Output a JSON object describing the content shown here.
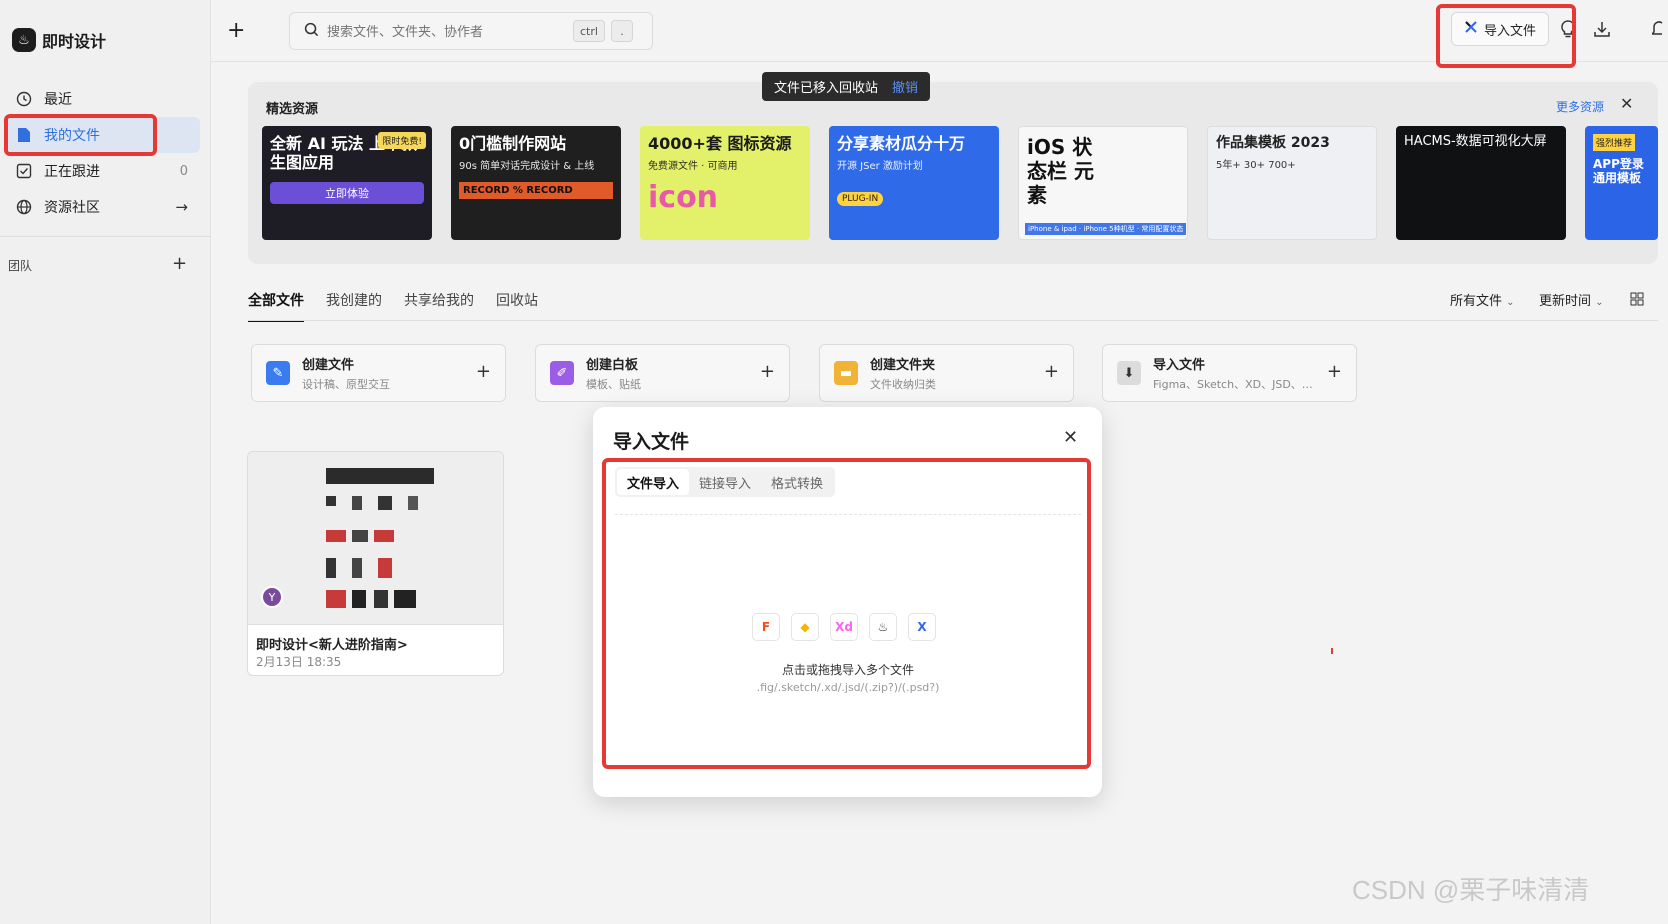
{
  "app": {
    "logo_glyph": "♨",
    "name": "即时设计"
  },
  "sidebar": {
    "items": [
      {
        "label": "最近",
        "icon": "clock-icon",
        "tail": ""
      },
      {
        "label": "我的文件",
        "icon": "file-icon",
        "tail": ""
      },
      {
        "label": "正在跟进",
        "icon": "follow-icon",
        "tail": "0"
      },
      {
        "label": "资源社区",
        "icon": "globe-icon",
        "tail": "→"
      }
    ],
    "team_label": "团队",
    "team_add": "+"
  },
  "topbar": {
    "new": "+",
    "search_placeholder": "搜索文件、文件夹、协作者",
    "kbd_ctrl": "ctrl",
    "kbd_dot": ".",
    "import_label": "导入文件",
    "icons": [
      "bulb-icon",
      "download-icon",
      "bell-icon"
    ]
  },
  "toast": {
    "text": "文件已移入回收站",
    "undo": "撤销"
  },
  "featured": {
    "title": "精选资源",
    "more": "更多资源",
    "close": "✕",
    "cards": [
      {
        "title": "全新 AI 玩法 上千款生图应用",
        "sub": "立即体验",
        "badge": "限时免费!",
        "bg": "#1e1c24",
        "fg": "#ffffff"
      },
      {
        "title": "0门槛制作网站",
        "sub": "90s 简单对话完成设计 & 上线",
        "badge": "RECORD % RECORD",
        "bg": "#1f1f1f",
        "fg": "#ffffff"
      },
      {
        "title": "4000+套 图标资源",
        "sub": "免费源文件 · 可商用",
        "badge": "icon",
        "bg": "#e3f16a",
        "fg": "#1a1a1a"
      },
      {
        "title": "分享素材瓜分十万",
        "sub": "开源 JSer 激励计划",
        "badge": "PLUG-IN",
        "bg": "#2f6ae8",
        "fg": "#ffffff"
      },
      {
        "title": "iOS 状态栏 元素",
        "sub": "iPhone & ipad · iPhone 5种机型 · 常用配置状态",
        "badge": "",
        "bg": "#f7f7f7",
        "fg": "#111111"
      },
      {
        "title": "作品集模板 2023",
        "sub": "5年+ 30+ 700+",
        "badge": "",
        "bg": "#eef0f4",
        "fg": "#222222"
      },
      {
        "title": "HACMS-数据可视化大屏",
        "sub": "",
        "badge": "",
        "bg": "#0f1112",
        "fg": "#ffffff"
      },
      {
        "title": "APP登录 通用模板",
        "sub": "",
        "badge": "强烈推荐",
        "bg": "#2c64e8",
        "fg": "#ffffff"
      }
    ]
  },
  "tabs": [
    "全部文件",
    "我创建的",
    "共享给我的",
    "回收站"
  ],
  "sort": {
    "filter": "所有文件",
    "order": "更新时间",
    "view_icon": "grid-icon"
  },
  "create": [
    {
      "title": "创建文件",
      "sub": "设计稿、原型交互",
      "color": "#3a7cf0",
      "glyph": "✎"
    },
    {
      "title": "创建白板",
      "sub": "模板、贴纸",
      "color": "#9b5de5",
      "glyph": "✐"
    },
    {
      "title": "创建文件夹",
      "sub": "文件收纳归类",
      "color": "#f0b336",
      "glyph": "▬"
    },
    {
      "title": "导入文件",
      "sub": "Figma、Sketch、XD、JSD、…",
      "color": "#555555",
      "glyph": "⬇"
    }
  ],
  "file": {
    "name": "即时设计<新人进阶指南>",
    "date": "2月13日 18:35",
    "avatar": "Y"
  },
  "dialog": {
    "title": "导入文件",
    "close": "✕",
    "tabs": [
      "文件导入",
      "链接导入",
      "格式转换"
    ],
    "formats": [
      {
        "label": "F",
        "color": "#f24e1e"
      },
      {
        "label": "◆",
        "color": "#f7b500"
      },
      {
        "label": "Xd",
        "color": "#ff61f6"
      },
      {
        "label": "♨",
        "color": "#333333"
      },
      {
        "label": "X",
        "color": "#2f6ae8"
      }
    ],
    "drop_text": "点击或拖拽导入多个文件",
    "drop_sub": ".fig/.sketch/.xd/.jsd/(.zip?)/(.psd?)"
  },
  "watermark": "CSDN @栗子味清清"
}
